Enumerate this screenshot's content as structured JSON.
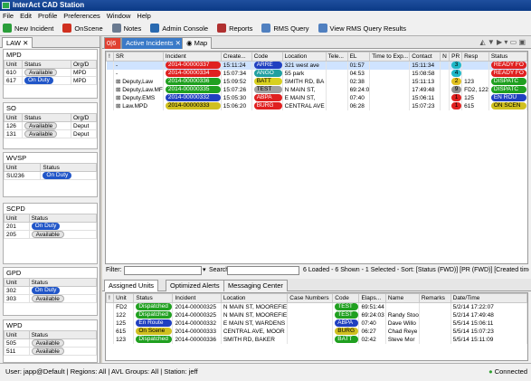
{
  "window": {
    "title": "InterAct CAD Station"
  },
  "menu": [
    "File",
    "Edit",
    "Profile",
    "Preferences",
    "Window",
    "Help"
  ],
  "toolbar": [
    {
      "label": "New Incident",
      "color": "#2a9e3a"
    },
    {
      "label": "OnScene",
      "color": "#d03020"
    },
    {
      "label": "Notes",
      "color": "#6a7a90"
    },
    {
      "label": "Admin Console",
      "color": "#2a6ab0"
    },
    {
      "label": "Reports",
      "color": "#b03030"
    },
    {
      "label": "RMS Query",
      "color": "#5080c0"
    },
    {
      "label": "View RMS Query Results",
      "color": "#5080c0"
    }
  ],
  "left": {
    "tab": "LAW",
    "groups": [
      {
        "title": "MPD",
        "cols": [
          "Unit",
          "Status",
          "Org/D"
        ],
        "rows": [
          [
            "610",
            "Available",
            "MPD"
          ],
          [
            "617",
            "On Duty",
            "MPD"
          ]
        ]
      },
      {
        "title": "SO",
        "cols": [
          "Unit",
          "Status",
          "Org/D"
        ],
        "rows": [
          [
            "126",
            "Available",
            "Deput"
          ],
          [
            "131",
            "Available",
            "Deput"
          ]
        ]
      },
      {
        "title": "WVSP",
        "cols": [
          "Unit",
          "Status"
        ],
        "rows": [
          [
            "SU236",
            "On Duty"
          ]
        ]
      },
      {
        "title": "SCPD",
        "cols": [
          "Unit",
          "Status"
        ],
        "rows": [
          [
            "201",
            "On Duty"
          ],
          [
            "205",
            "Available"
          ]
        ]
      },
      {
        "title": "GPD",
        "cols": [
          "Unit",
          "Status"
        ],
        "rows": [
          [
            "302",
            "On Duty"
          ],
          [
            "303",
            "Available"
          ]
        ]
      },
      {
        "title": "WPD",
        "cols": [
          "Unit",
          "Status"
        ],
        "rows": [
          [
            "505",
            "Available"
          ],
          [
            "511",
            "Available"
          ]
        ]
      }
    ]
  },
  "main": {
    "tabs": [
      "Active Incidents",
      "Map"
    ],
    "incident_cols": [
      "!",
      "SR",
      "Incident",
      "Create...",
      "Code",
      "Location",
      "Tele...",
      "EL",
      "Time to Exp...",
      "Contact",
      "N",
      "PR",
      "Resp",
      "Status"
    ],
    "incidents": [
      {
        "sr": "-",
        "inc": "2014-00000337",
        "incColor": "#e02020",
        "created": "15:11:24",
        "code": "ARRE",
        "codeColor": "#2040c0",
        "loc": "321 west ave",
        "el": "01:57",
        "contact": "15:11:34",
        "pr": "3",
        "prColor": "#20b8c8",
        "resp": "",
        "status": "READY FO",
        "statusColor": "#e02020",
        "sel": true
      },
      {
        "sr": "-",
        "inc": "2014-00000334",
        "incColor": "#e02020",
        "created": "15:07:34",
        "code": "ANGO",
        "codeColor": "#20a0a0",
        "loc": "55 park",
        "el": "04:53",
        "contact": "15:08:58",
        "pr": "4",
        "prColor": "#20b8c8",
        "resp": "",
        "status": "READY FO",
        "statusColor": "#e02020",
        "sel": false
      },
      {
        "sr": "Deputy,Law",
        "inc": "2014-00000336",
        "incColor": "#20a020",
        "created": "15:09:52",
        "code": "BATT",
        "codeColor": "#d8d020",
        "loc": "SMITH RD, BA",
        "el": "02:38",
        "contact": "15:11:13",
        "pr": "2",
        "prColor": "#e0c020",
        "resp": "123",
        "status": "DISPATC",
        "statusColor": "#20a020",
        "sel": false
      },
      {
        "sr": "Deputy,Law.MF",
        "inc": "2014-00000335",
        "incColor": "#20a020",
        "created": "15:07:26",
        "code": "TEST",
        "codeColor": "#a0a0a0",
        "loc": "N MAIN ST,",
        "el": "69:24:0",
        "contact": "17:49:48",
        "pr": "9",
        "prColor": "#909090",
        "resp": "FD2, 122",
        "status": "DISPATC",
        "statusColor": "#20a020",
        "sel": false
      },
      {
        "sr": "Deputy.EMS",
        "inc": "2014-00000332",
        "incColor": "#2040c0",
        "created": "15:05:30",
        "code": "ABPA",
        "codeColor": "#e02020",
        "loc": "E MAIN ST,",
        "el": "07:40",
        "contact": "15:06:11",
        "pr": "1",
        "prColor": "#e02020",
        "resp": "125",
        "status": "EN ROU",
        "statusColor": "#2040c0",
        "sel": false
      },
      {
        "sr": "Law.MPD",
        "inc": "2014-00000333",
        "incColor": "#d0c020",
        "created": "15:06:20",
        "code": "BURG",
        "codeColor": "#e02020",
        "loc": "CENTRAL AVE",
        "el": "06:28",
        "contact": "15:07:23",
        "pr": "1",
        "prColor": "#e02020",
        "resp": "615",
        "status": "ON SCEN",
        "statusColor": "#d0c020",
        "sel": false
      }
    ],
    "filter": {
      "label": "Filter:",
      "search": "Search:",
      "summary": "6 Loaded - 6 Shown - 1 Selected - Sort: [Status (FWD)] [PR (FWD)] [Created time"
    },
    "bottom_tabs": [
      "Assigned Units",
      "Optimized Alerts",
      "Messaging Center"
    ],
    "unit_cols": [
      "!",
      "Unit",
      "Status",
      "Incident",
      "Location",
      "Case Numbers",
      "Code",
      "Elaps...",
      "Name",
      "Remarks",
      "Date/Time"
    ],
    "units": [
      {
        "unit": "FD2",
        "status": "Dispatched",
        "stColor": "#20a020",
        "inc": "2014-00000325",
        "loc": "N MAIN ST, MOOREFIE",
        "code": "TEST",
        "codeColor": "#20a020",
        "el": "69:51:44",
        "name": "",
        "date": "5/2/14 17:22:07"
      },
      {
        "unit": "122",
        "status": "Dispatched",
        "stColor": "#20a020",
        "inc": "2014-00000325",
        "loc": "N MAIN ST, MOOREFIE",
        "code": "TEST",
        "codeColor": "#20a020",
        "el": "69:24:03",
        "name": "Randy Stoo",
        "date": "5/2/14 17:49:48"
      },
      {
        "unit": "125",
        "status": "En Route",
        "stColor": "#2040c0",
        "inc": "2014-00000332",
        "loc": "E MAIN ST, WARDENS",
        "code": "ABPA",
        "codeColor": "#2040c0",
        "el": "07:40",
        "name": "Dave Willo",
        "date": "5/5/14 15:06:11"
      },
      {
        "unit": "615",
        "status": "On Scene",
        "stColor": "#d0c020",
        "inc": "2014-00000333",
        "loc": "CENTRAL AVE, MOOR",
        "code": "BURG",
        "codeColor": "#d0c020",
        "el": "06:27",
        "name": "Chad Reye",
        "date": "5/5/14 15:07:23"
      },
      {
        "unit": "123",
        "status": "Dispatched",
        "stColor": "#20a020",
        "inc": "2014-00000336",
        "loc": "SMITH RD, BAKER",
        "code": "BATT",
        "codeColor": "#20a020",
        "el": "02:42",
        "name": "Steve Mor",
        "date": "5/5/14 15:11:09"
      }
    ]
  },
  "status": {
    "user": "User: japp@Default",
    "regions": "Regions: All",
    "avl": "AVL Groups: All",
    "station": "Station: jeff",
    "connected": "Connected"
  }
}
